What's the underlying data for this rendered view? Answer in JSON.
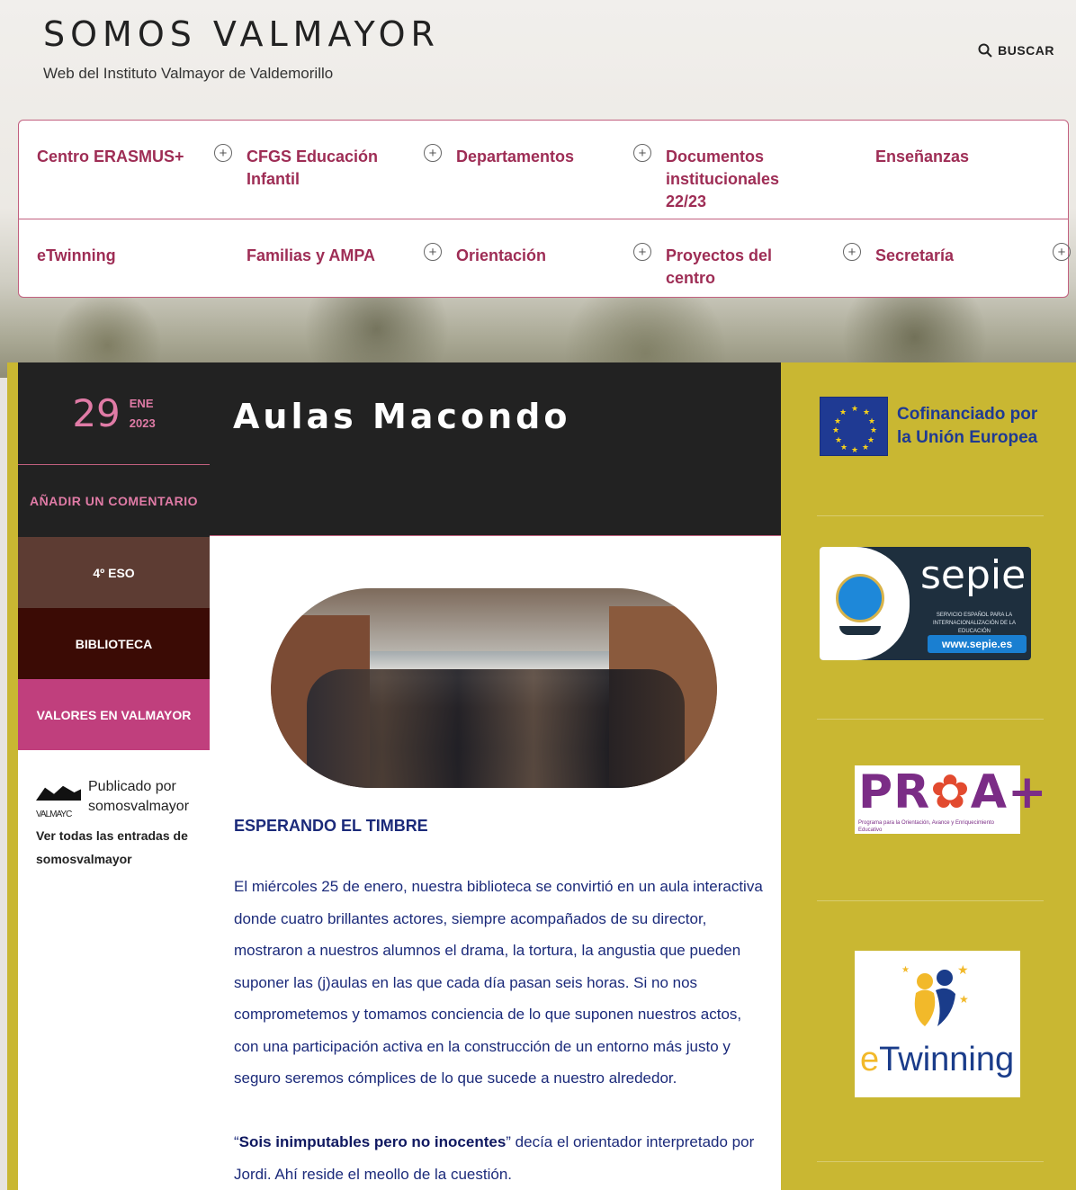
{
  "site": {
    "title": "SOMOS VALMAYOR",
    "description": "Web del Instituto Valmayor de Valdemorillo",
    "search_label": "BUSCAR"
  },
  "menu": {
    "row1": [
      {
        "label": "Centro ERASMUS+",
        "has_sub": true
      },
      {
        "label": "CFGS Educación Infantil",
        "has_sub": true
      },
      {
        "label": "Departamentos",
        "has_sub": true
      },
      {
        "label": "Documentos institucionales 22/23",
        "has_sub": false
      },
      {
        "label": "Enseñanzas",
        "has_sub": false
      }
    ],
    "row2": [
      {
        "label": "eTwinning",
        "has_sub": false
      },
      {
        "label": "Familias y AMPA",
        "has_sub": true
      },
      {
        "label": "Orientación",
        "has_sub": true
      },
      {
        "label": "Proyectos del centro",
        "has_sub": true
      },
      {
        "label": "Secretaría",
        "has_sub": true
      }
    ]
  },
  "post": {
    "date_day": "29",
    "date_month": "ENE",
    "date_year": "2023",
    "comment_label": "AÑADIR UN COMENTARIO",
    "categories": [
      "4º ESO",
      "BIBLIOTECA",
      "VALORES EN VALMAYOR"
    ],
    "author_prefix": "Publicado por",
    "author_name": "somosvalmayor",
    "author_link": "Ver todas las entradas de somosvalmayor",
    "avatar_text": "VALMAYC",
    "title": "Aulas Macondo",
    "subheading": "ESPERANDO EL TIMBRE",
    "paragraph1": "El miércoles 25 de enero, nuestra biblioteca se convirtió en un aula interactiva donde cuatro brillantes actores, siempre acompañados de su director, mostraron a nuestros alumnos el drama, la tortura, la angustia que pueden suponer las (j)aulas en las que cada día pasan seis horas. Si no nos comprometemos y tomamos conciencia de lo que suponen nuestros actos, con una participación activa en la construcción de un entorno más justo y seguro seremos cómplices de lo que sucede a nuestro alrededor.",
    "quote": "Sois inimputables pero no inocentes",
    "paragraph2_rest": " decía el orientador interpretado por Jordi. Ahí reside el meollo de la cuestión."
  },
  "sidebar": {
    "eu_text_line1": "Cofinanciado por",
    "eu_text_line2": "la Unión Europea",
    "sepie_name": "sepie",
    "sepie_small": "SERVICIO ESPAÑOL PARA LA INTERNACIONALIZACIÓN DE LA EDUCACIÓN",
    "sepie_url": "www.sepie.es",
    "proa_sub": "Programa para la Orientación, Avance y Enriquecimiento Educativo",
    "etwinning_e": "e",
    "etwinning_rest": "Twinning"
  },
  "colors": {
    "menu_text": "#9e2d55",
    "sidebar_bg": "#c9b732",
    "dark_bg": "#222222",
    "accent_pink": "#e07ba6",
    "body_text": "#1b2a7a"
  },
  "icons": [
    "search-icon",
    "plus-circle-icon",
    "eu-flag-icon",
    "globe-icon",
    "proa-logo",
    "etwinning-logo"
  ]
}
